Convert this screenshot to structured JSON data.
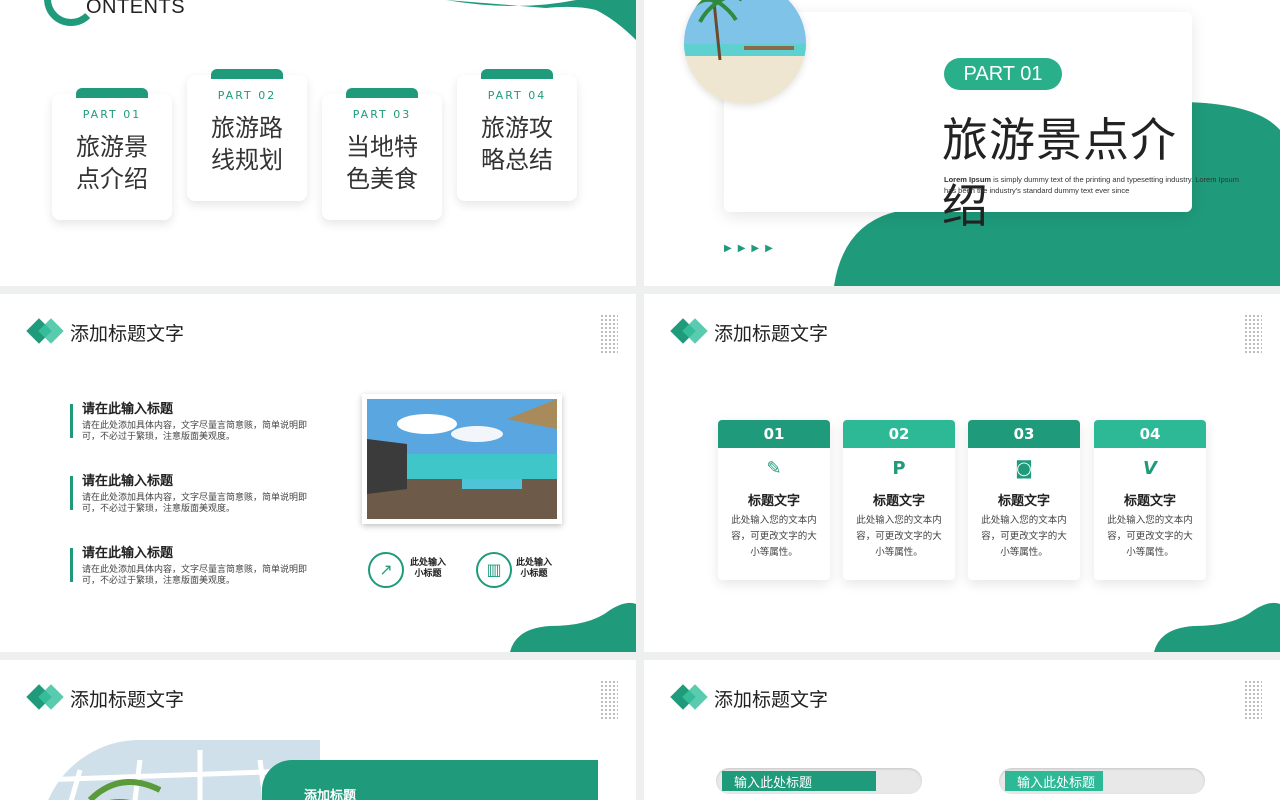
{
  "colors": {
    "accent": "#1f9b7b",
    "accent_light": "#3cc2a0"
  },
  "slide1": {
    "title": "ONTENTS",
    "cards": [
      {
        "part": "PART 01",
        "name": "旅游景点介绍"
      },
      {
        "part": "PART 02",
        "name": "旅游路线规划"
      },
      {
        "part": "PART 03",
        "name": "当地特色美食"
      },
      {
        "part": "PART 04",
        "name": "旅游攻略总结"
      }
    ]
  },
  "slide2": {
    "part": "PART 01",
    "title": "旅游景点介绍",
    "lorem_bold": "Lorem Ipsum",
    "lorem_rest": " is simply dummy text of the printing and typesetting industry. Lorem Ipsum has been the industry's standard dummy text ever since",
    "arrows": "▶▶▶▶"
  },
  "section_title": "添加标题文字",
  "slide3": {
    "items": [
      {
        "heading": "请在此输入标题",
        "body": "请在此处添加具体内容，文字尽量言简意赅，简单说明即可，不必过于繁琐，注意版面美观度。"
      },
      {
        "heading": "请在此输入标题",
        "body": "请在此处添加具体内容，文字尽量言简意赅，简单说明即可，不必过于繁琐，注意版面美观度。"
      },
      {
        "heading": "请在此输入标题",
        "body": "请在此处添加具体内容，文字尽量言简意赅，简单说明即可，不必过于繁琐，注意版面美观度。"
      }
    ],
    "icon_labels": [
      {
        "line1": "此处输入",
        "line2": "小标题",
        "icon": "trend-chart-icon"
      },
      {
        "line1": "此处输入",
        "line2": "小标题",
        "icon": "bar-chart-icon"
      }
    ]
  },
  "slide4": {
    "columns": [
      {
        "num": "01",
        "title": "标题文字",
        "desc": "此处输入您的文本内容，可更改文字的大小等属性。",
        "icon": "edit-icon",
        "glyph": "✎"
      },
      {
        "num": "02",
        "title": "标题文字",
        "desc": "此处输入您的文本内容，可更改文字的大小等属性。",
        "icon": "pinterest-icon",
        "glyph": "P"
      },
      {
        "num": "03",
        "title": "标题文字",
        "desc": "此处输入您的文本内容，可更改文字的大小等属性。",
        "icon": "instagram-icon",
        "glyph": "◙"
      },
      {
        "num": "04",
        "title": "标题文字",
        "desc": "此处输入您的文本内容，可更改文字的大小等属性。",
        "icon": "vimeo-icon",
        "glyph": "V"
      }
    ]
  },
  "slide5": {
    "band_title": "添加标题"
  },
  "slide6": {
    "bars": [
      {
        "label": "输入此处标题"
      },
      {
        "label": "输入此处标题"
      }
    ]
  }
}
